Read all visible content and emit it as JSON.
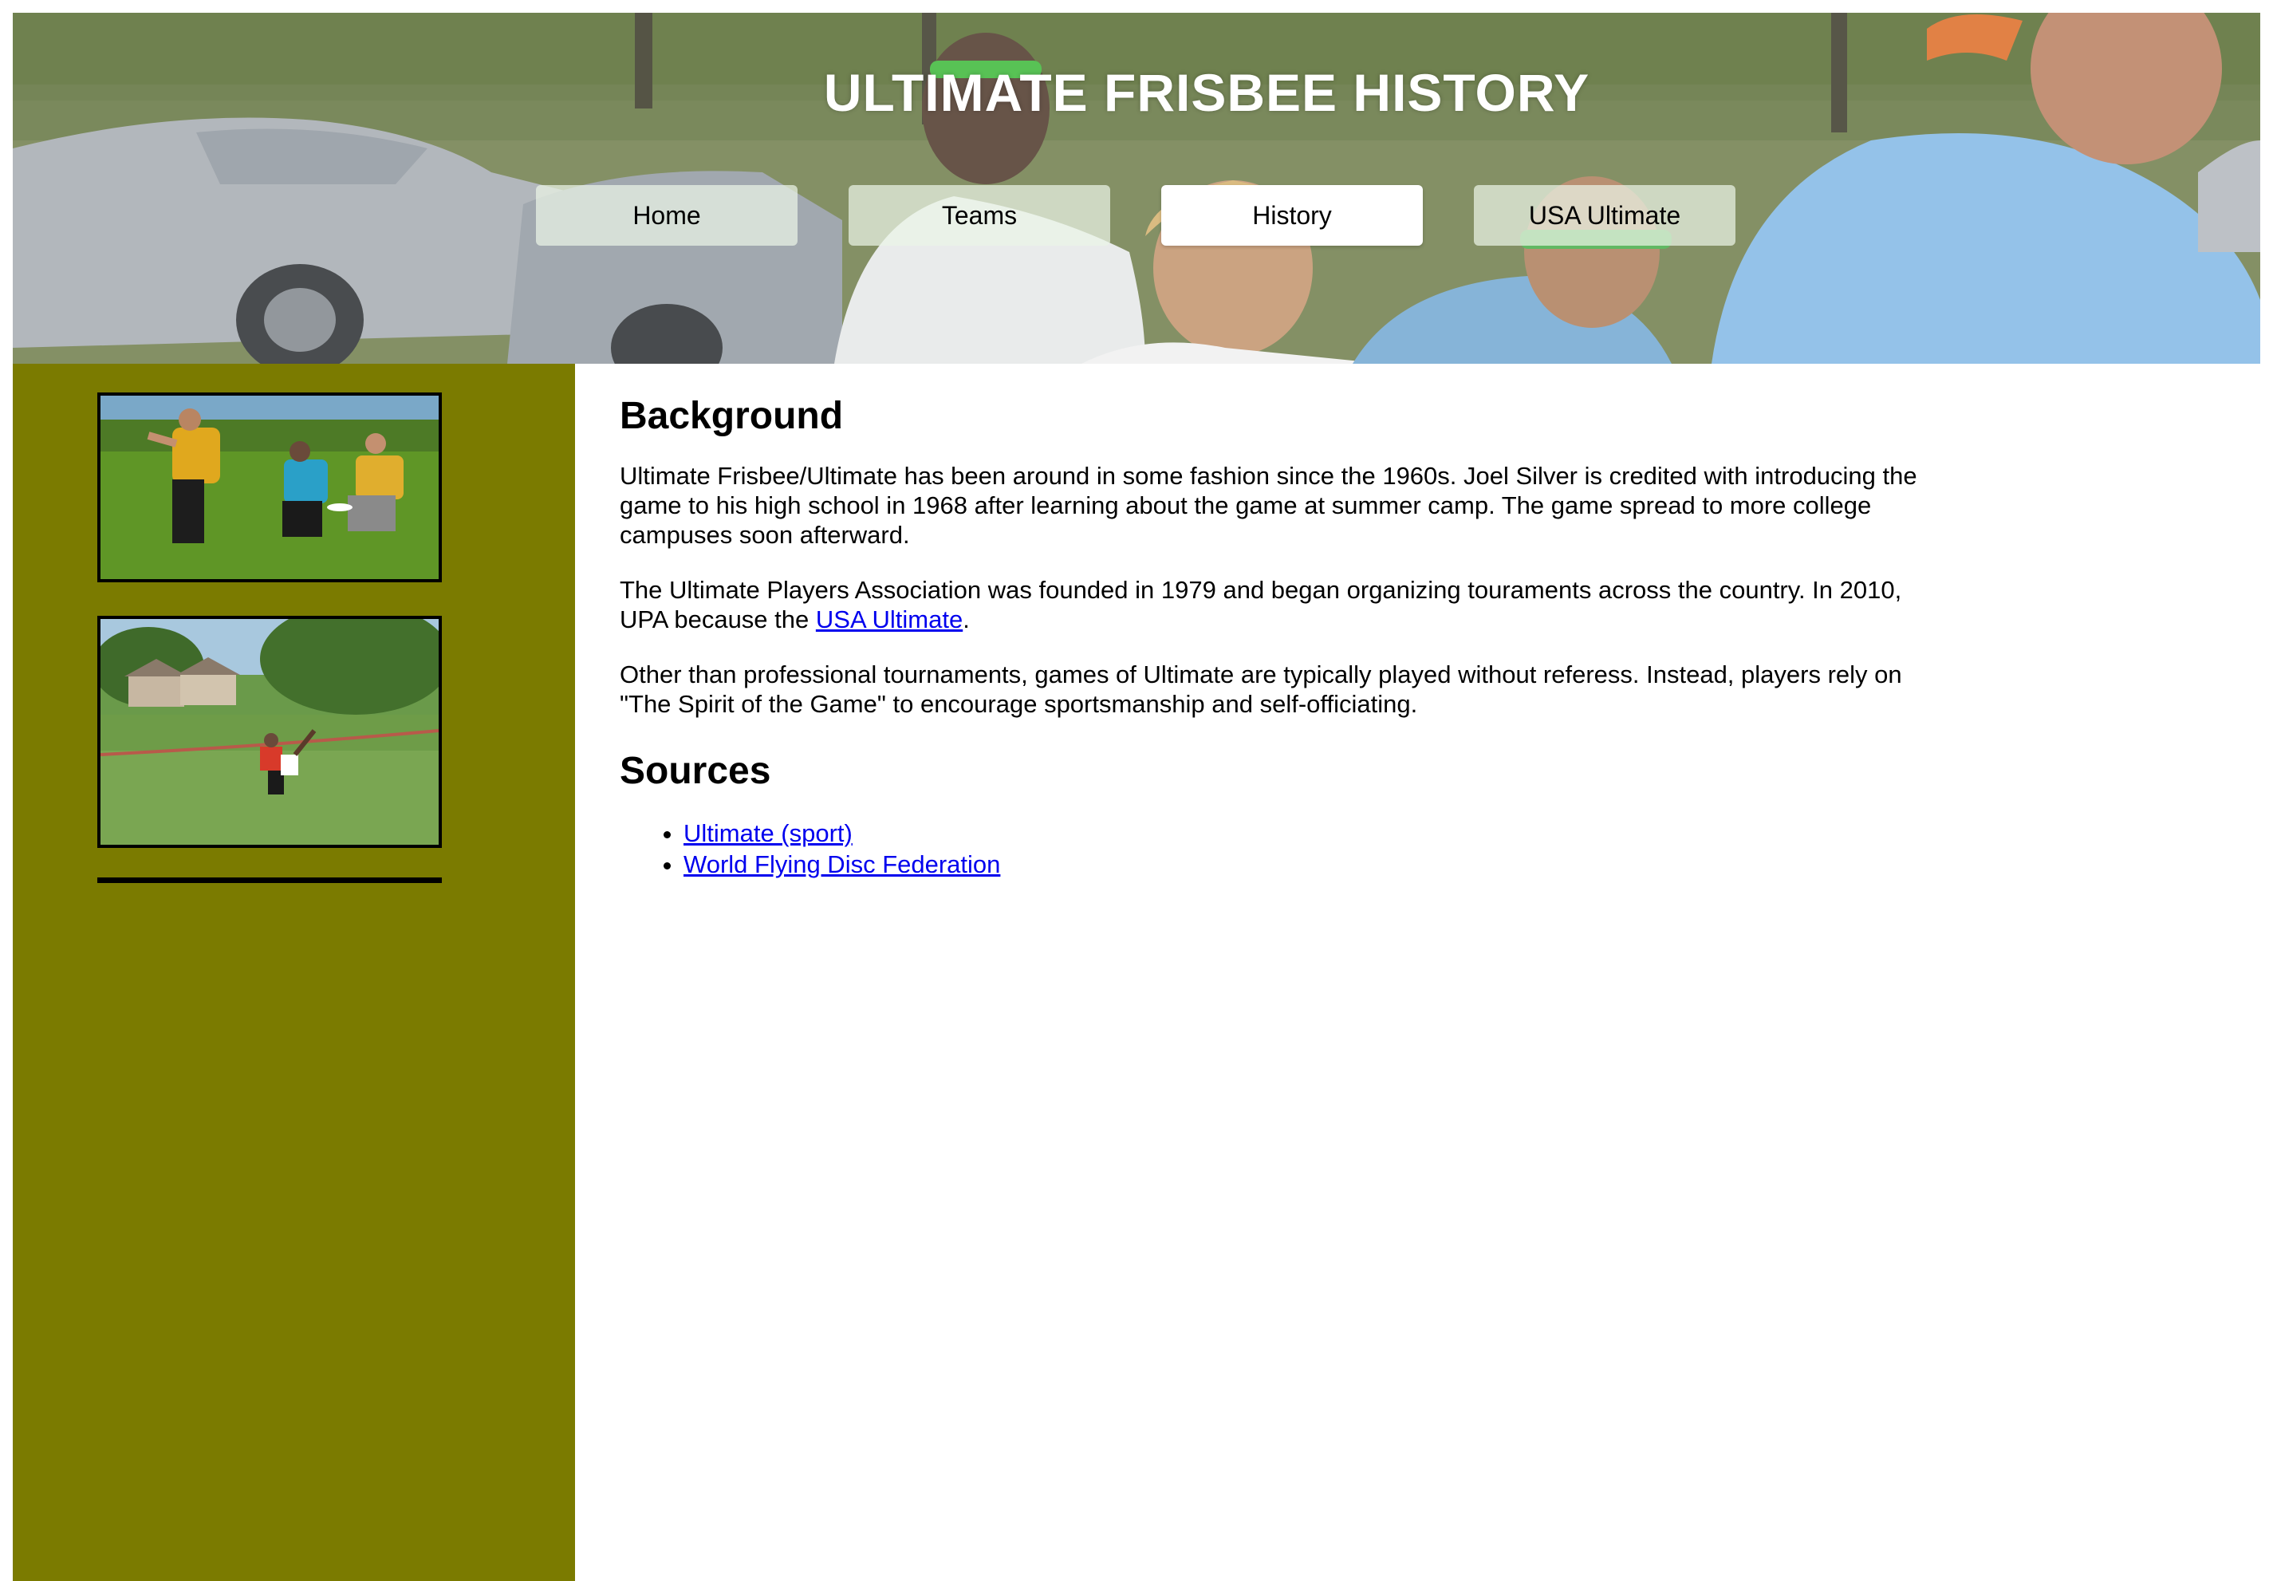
{
  "header": {
    "title": "ULTIMATE FRISBEE HISTORY",
    "photo": "ultimate-players-running-photo"
  },
  "nav": {
    "items": [
      {
        "label": "Home",
        "active": false
      },
      {
        "label": "Teams",
        "active": false
      },
      {
        "label": "History",
        "active": true
      },
      {
        "label": "USA Ultimate",
        "active": false
      }
    ]
  },
  "sidebar": {
    "background": "#7b7b00",
    "photos": [
      "ultimate-game-photo",
      "field-layout-catch-photo"
    ]
  },
  "main": {
    "background_heading": "Background",
    "para1": "Ultimate Frisbee/Ultimate has been around in some fashion since the 1960s. Joel Silver is credited with introducing the game to his high school in 1968 after learning about the game at summer camp. The game spread to more college campuses soon afterward.",
    "para2_before": "The Ultimate Players Association was founded in 1979 and began organizing touraments across the country. In 2010, UPA because the ",
    "para2_link": "USA Ultimate",
    "para2_after": ".",
    "para3": "Other than professional tournaments, games of Ultimate are typically played without referess. Instead, players rely on \"The Spirit of the Game\" to encourage sportsmanship and self-officiating.",
    "sources_heading": "Sources",
    "sources": [
      {
        "label": "Ultimate (sport)"
      },
      {
        "label": "World Flying Disc Federation"
      }
    ]
  },
  "colors": {
    "sidebar": "#7b7b00",
    "link": "#0000ee",
    "title": "#ffffff"
  }
}
